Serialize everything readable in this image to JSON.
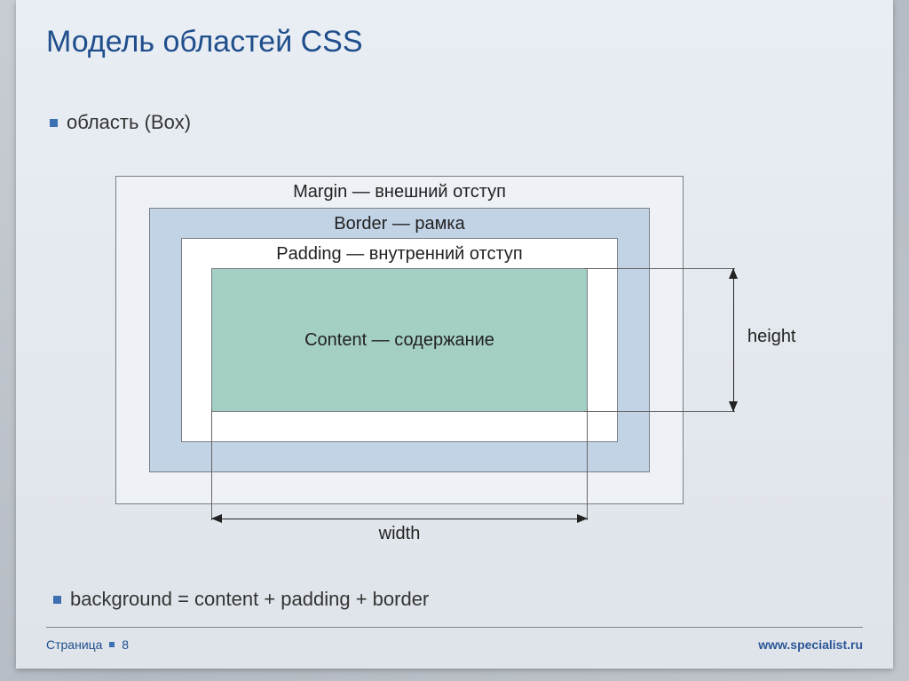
{
  "title": "Модель областей CSS",
  "bullets": [
    "область (Box)",
    "background = content + padding + border"
  ],
  "diagram": {
    "margin": "Margin — внешний отступ",
    "border": "Border — рамка",
    "padding": "Padding — внутренний отступ",
    "content": "Content — содержание",
    "width": "width",
    "height": "height"
  },
  "footer": {
    "page_label": "Страница",
    "page_number": "8",
    "site": "www.specialist.ru"
  }
}
